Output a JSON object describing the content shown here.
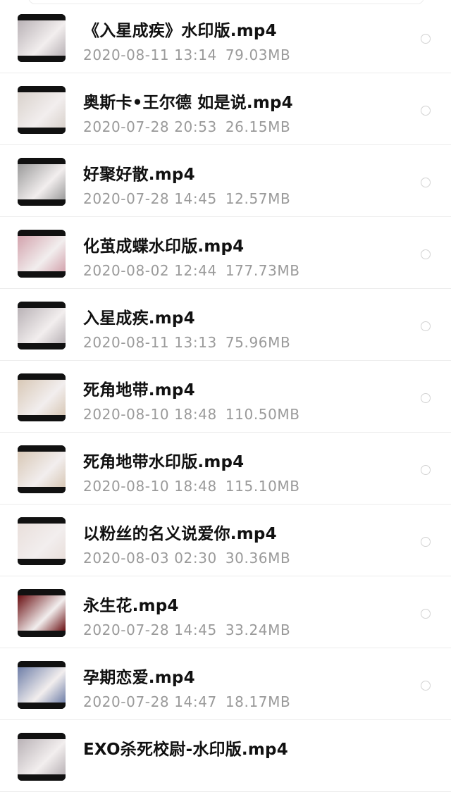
{
  "files": [
    {
      "name": "《入星成疾》水印版.mp4",
      "date": "2020-08-11",
      "time": "13:14",
      "size": "79.03MB",
      "thumb": "grey-portrait"
    },
    {
      "name": "奥斯卡•王尔德 如是说.mp4",
      "date": "2020-07-28",
      "time": "20:53",
      "size": "26.15MB",
      "thumb": "pale-couple"
    },
    {
      "name": "好聚好散.mp4",
      "date": "2020-07-28",
      "time": "14:45",
      "size": "12.57MB",
      "thumb": "grey-mono"
    },
    {
      "name": "化茧成蝶水印版.mp4",
      "date": "2020-08-02",
      "time": "12:44",
      "size": "177.73MB",
      "thumb": "pink-blur"
    },
    {
      "name": "入星成疾.mp4",
      "date": "2020-08-11",
      "time": "13:13",
      "size": "75.96MB",
      "thumb": "grey-portrait"
    },
    {
      "name": "死角地带.mp4",
      "date": "2020-08-10",
      "time": "18:48",
      "size": "110.50MB",
      "thumb": "blonde-face"
    },
    {
      "name": "死角地带水印版.mp4",
      "date": "2020-08-10",
      "time": "18:48",
      "size": "115.10MB",
      "thumb": "blonde-face"
    },
    {
      "name": "以粉丝的名义说爱你.mp4",
      "date": "2020-08-03",
      "time": "02:30",
      "size": "30.36MB",
      "thumb": "dark-hair-face"
    },
    {
      "name": "永生花.mp4",
      "date": "2020-07-28",
      "time": "14:45",
      "size": "33.24MB",
      "thumb": "red-stage"
    },
    {
      "name": "孕期恋爱.mp4",
      "date": "2020-07-28",
      "time": "14:47",
      "size": "18.17MB",
      "thumb": "blue-portrait"
    },
    {
      "name": "EXO杀死校尉-水印版.mp4",
      "date": "",
      "time": "",
      "size": "",
      "thumb": "grey-portrait"
    }
  ],
  "thumb_colors": {
    "grey-portrait": "#b9b2b6",
    "pale-couple": "#d9d2cc",
    "grey-mono": "#9b9b9b",
    "pink-blur": "#d3a3ad",
    "blonde-face": "#d8c8b6",
    "dark-hair-face": "#e9dfdb",
    "red-stage": "#6a0f12",
    "blue-portrait": "#6f7fa8"
  }
}
